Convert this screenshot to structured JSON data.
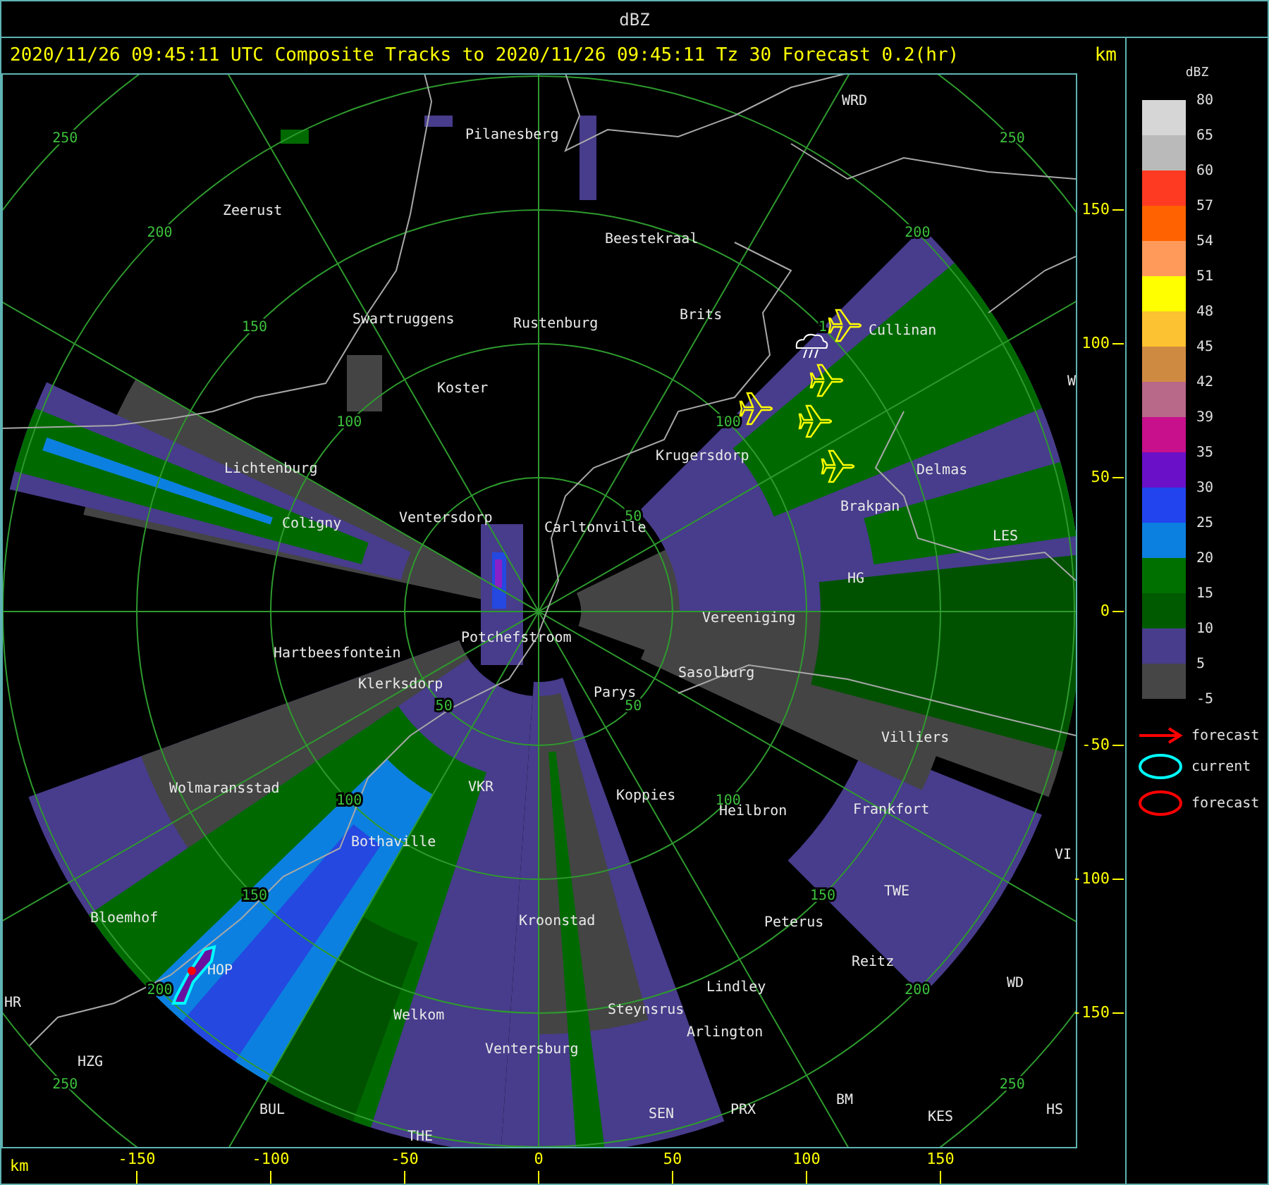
{
  "title_bar": {
    "title": "dBZ"
  },
  "header": {
    "caption": "2020/11/26 09:45:11 UTC Composite Tracks to 2020/11/26 09:45:11 Tz 30 Forecast 0.2(hr)",
    "unit": "km"
  },
  "map": {
    "places": [
      "Pilanesberg",
      "Beestekraal",
      "Zeerust",
      "Swartruggens",
      "Rustenburg",
      "Brits",
      "Cullinan",
      "Koster",
      "WRD",
      "W",
      "Lichtenburg",
      "Krugersdorp",
      "Delmas",
      "Coligny",
      "Ventersdorp",
      "Carltonville",
      "Brakpan",
      "LES",
      "HG",
      "Vereeniging",
      "Hartbeesfontein",
      "Potchefstroom",
      "Klerksdorp",
      "Parys",
      "Sasolburg",
      "Villiers",
      "Wolmaransstad",
      "VKR",
      "Koppies",
      "Heilbron",
      "Frankfort",
      "Bothaville",
      "VI",
      "TWE",
      "Bloemhof",
      "Kroonstad",
      "Peterus",
      "HOP",
      "Reitz",
      "HR",
      "Lindley",
      "WD",
      "Welkom",
      "Steynsrus",
      "Arlington",
      "HZG",
      "Ventersburg",
      "BUL",
      "SEN",
      "PRX",
      "BM",
      "KES",
      "HS",
      "THE"
    ],
    "range_labels": [
      {
        "labels": [
          "100",
          "150",
          "200",
          "250"
        ]
      },
      {
        "labels": [
          "50",
          "100",
          "1",
          "200",
          "250"
        ]
      },
      {
        "labels": [
          "50",
          "100",
          "150",
          "200",
          "250"
        ]
      },
      {
        "labels": [
          "50",
          "100",
          "150",
          "200",
          "250"
        ]
      }
    ]
  },
  "y_axis": {
    "ticks": [
      "150",
      "100",
      "50",
      "0",
      "-50",
      "-100",
      "-150"
    ]
  },
  "x_axis": {
    "unit": "km",
    "ticks": [
      "-150",
      "-100",
      "-50",
      "0",
      "50",
      "100",
      "150"
    ]
  },
  "legend": {
    "title": "dBZ",
    "levels": [
      "80",
      "65",
      "60",
      "57",
      "54",
      "51",
      "48",
      "45",
      "42",
      "39",
      "35",
      "30",
      "25",
      "20",
      "15",
      "10",
      "5",
      "-5"
    ],
    "bins": [
      {
        "color": "#d6d6d6"
      },
      {
        "color": "#bababa"
      },
      {
        "color": "#ff3a22"
      },
      {
        "color": "#ff6200"
      },
      {
        "color": "#ff9a5a"
      },
      {
        "color": "#ffff00"
      },
      {
        "color": "#fcc232"
      },
      {
        "color": "#cf8a42"
      },
      {
        "color": "#b86888"
      },
      {
        "color": "#c8108c"
      },
      {
        "color": "#6a10c8"
      },
      {
        "color": "#2244ee"
      },
      {
        "color": "#0c80e0"
      },
      {
        "color": "#007000"
      },
      {
        "color": "#005a00"
      },
      {
        "color": "#483c8c"
      },
      {
        "color": "#464646"
      }
    ],
    "keys": [
      {
        "kind": "arrow",
        "label": "forecast",
        "color": "#ff0000"
      },
      {
        "kind": "ellipse",
        "label": "current",
        "color": "#00ffff"
      },
      {
        "kind": "ellipse",
        "label": "forecast",
        "color": "#ff0000"
      }
    ]
  }
}
